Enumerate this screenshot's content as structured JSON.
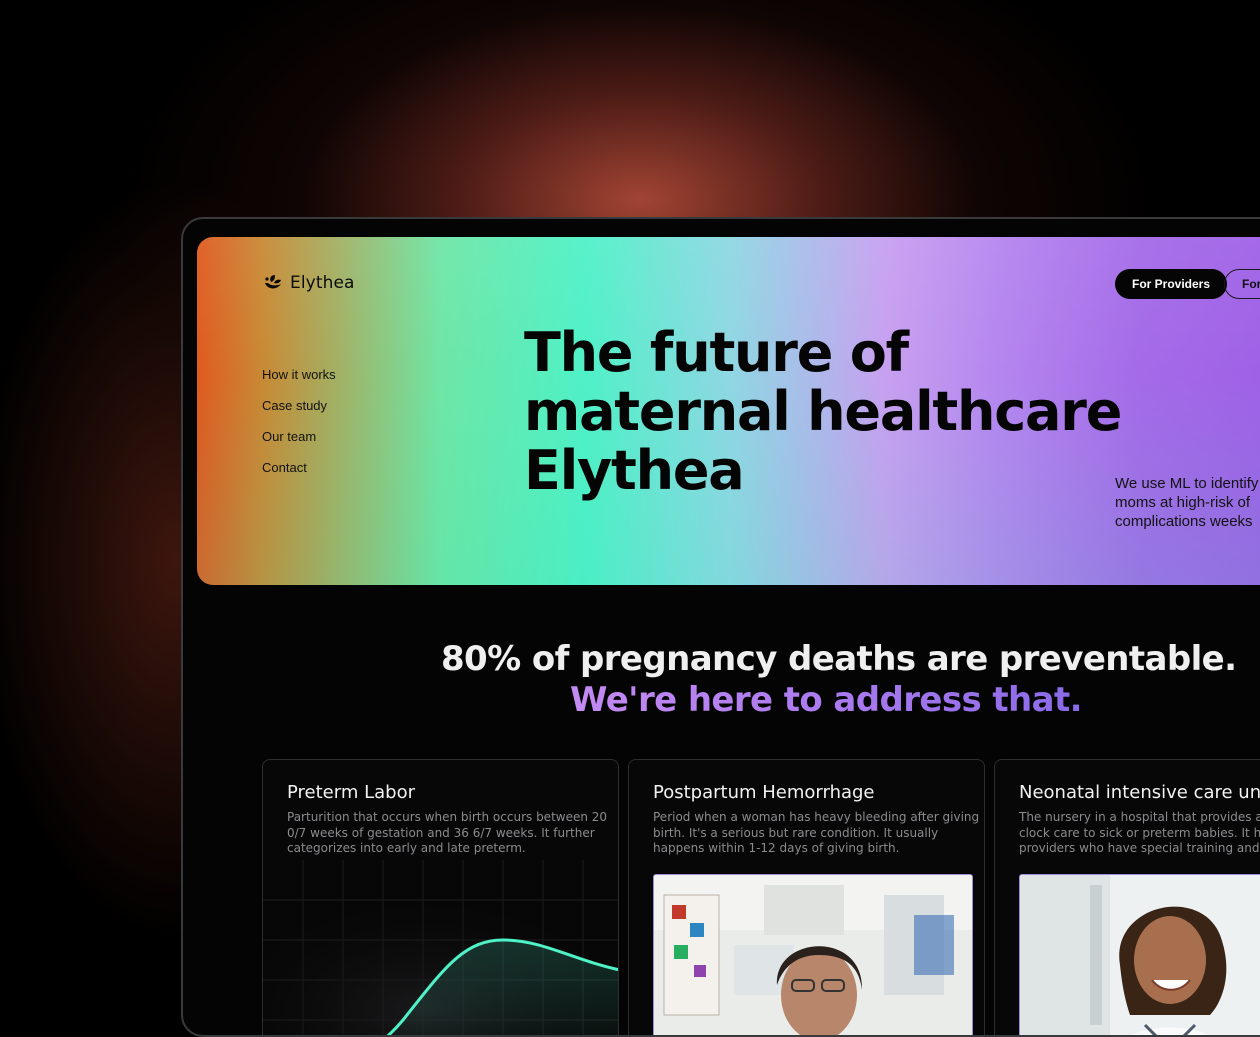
{
  "brand": {
    "name": "Elythea",
    "icon": "leaf-hands-icon"
  },
  "nav": {
    "items": [
      {
        "label": "How it works"
      },
      {
        "label": "Case study"
      },
      {
        "label": "Our team"
      },
      {
        "label": "Contact"
      }
    ]
  },
  "header_buttons": {
    "providers": "For Providers",
    "second": "For"
  },
  "hero": {
    "headline": [
      "The future of",
      "maternal healthcare",
      "Elythea"
    ],
    "description": [
      "We use ML to identify",
      "moms at high-risk of",
      "complications weeks"
    ]
  },
  "stat": {
    "line1": "80% of pregnancy deaths are preventable.",
    "line2": "We're here to address that."
  },
  "cards": [
    {
      "title": "Preterm Labor",
      "text": [
        "Parturition that occurs when birth occurs between 20",
        "0/7 weeks of gestation and 36 6/7 weeks. It further",
        "categorizes into early and late preterm."
      ],
      "visual": "line-chart"
    },
    {
      "title": "Postpartum Hemorrhage",
      "text": [
        "Period when a woman has heavy bleeding after giving",
        "birth. It's a serious but rare condition. It usually",
        "happens within 1-12 days of giving birth."
      ],
      "visual": "photo-provider"
    },
    {
      "title": "Neonatal intensive care unit",
      "text": [
        "The nursery in a hospital that provides around-the-",
        "clock care to sick or preterm babies. It has health",
        "providers who have special training and equipment."
      ],
      "visual": "photo-doctor"
    }
  ],
  "colors": {
    "accent_purple": "#a879ef",
    "accent_green": "#4ff1c7",
    "chart_line": "#4ff1c7",
    "background": "#000000"
  }
}
